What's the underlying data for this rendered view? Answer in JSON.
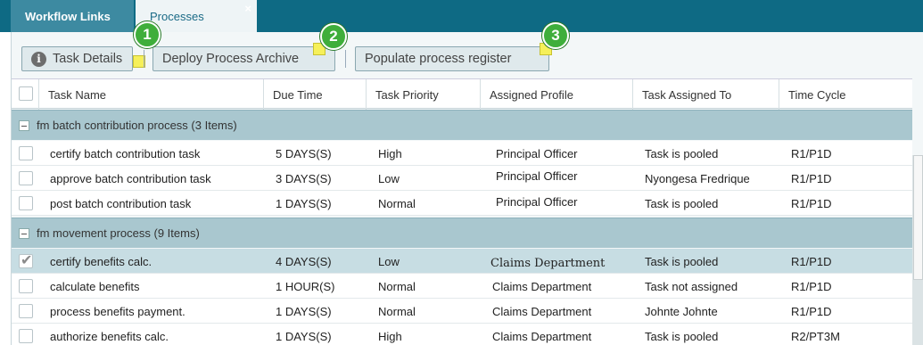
{
  "tabs": [
    {
      "label": "Workflow Links"
    },
    {
      "label": "Processes",
      "close": "×"
    }
  ],
  "toolbar": {
    "task_details": "Task Details",
    "deploy": "Deploy Process Archive",
    "populate": "Populate process register"
  },
  "badges": [
    "1",
    "2",
    "3"
  ],
  "columns": [
    "Task Name",
    "Due Time",
    "Task Priority",
    "Assigned Profile",
    "Task Assigned To",
    "Time Cycle"
  ],
  "groups": [
    {
      "label": "fm batch contribution process (3 Items)",
      "rows": [
        {
          "name": "certify batch contribution task",
          "due": "5 DAYS(S)",
          "priority": "High",
          "profile": "Principal Officer",
          "assigned": "Task is pooled",
          "cycle": "R1/P1D"
        },
        {
          "name": "approve batch contribution task",
          "due": "3 DAYS(S)",
          "priority": "Low",
          "profile": "Principal Officer",
          "assigned": "Nyongesa Fredrique",
          "cycle": "R1/P1D"
        },
        {
          "name": "post batch contribution task",
          "due": "1 DAYS(S)",
          "priority": "Normal",
          "profile": "Principal Officer",
          "assigned": "Task is pooled",
          "cycle": "R1/P1D"
        }
      ]
    },
    {
      "label": "fm movement process (9 Items)",
      "rows": [
        {
          "name": "certify benefits calc.",
          "due": "4 DAYS(S)",
          "priority": "Low",
          "profile": "Claims Department",
          "assigned": "Task is pooled",
          "cycle": "R1/P1D"
        },
        {
          "name": "calculate benefits",
          "due": "1 HOUR(S)",
          "priority": "Normal",
          "profile": "Claims Department",
          "assigned": "Task not assigned",
          "cycle": "R1/P1D"
        },
        {
          "name": "process benefits payment.",
          "due": "1 DAYS(S)",
          "priority": "Normal",
          "profile": "Claims Department",
          "assigned": "Johnte Johnte",
          "cycle": "R1/P1D"
        },
        {
          "name": "authorize benefits calc.",
          "due": "1 DAYS(S)",
          "priority": "High",
          "profile": "Claims Department",
          "assigned": "Task is pooled",
          "cycle": "R2/PT3M"
        }
      ]
    }
  ],
  "colors": {
    "header_bar": "#0e6a84",
    "group_row": "#a9c7cf",
    "selected_row": "#c7dde3",
    "badge": "#3fae3b",
    "highlight": "#f6f05a"
  }
}
